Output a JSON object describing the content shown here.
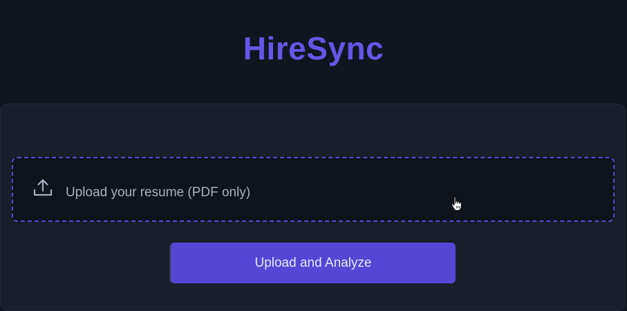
{
  "app": {
    "brand": "HireSync",
    "accent_color": "#6656e8"
  },
  "upload": {
    "icon": "upload-icon",
    "label": "Upload your resume (PDF only)",
    "border_color": "#5448d6"
  },
  "actions": {
    "submit_label": "Upload and Analyze",
    "submit_color": "#5646d6"
  },
  "pointer": {
    "icon": "hand-pointer-icon"
  }
}
